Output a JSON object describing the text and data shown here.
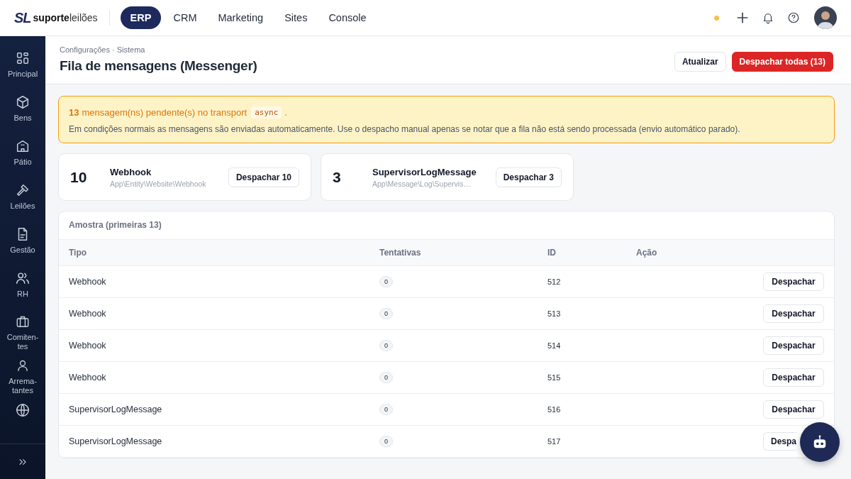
{
  "brand": {
    "mark": "SL",
    "name_bold": "suporte",
    "name_light": "leilões"
  },
  "nav": [
    {
      "label": "ERP",
      "selected": true
    },
    {
      "label": "CRM",
      "selected": false
    },
    {
      "label": "Marketing",
      "selected": false
    },
    {
      "label": "Sites",
      "selected": false
    },
    {
      "label": "Console",
      "selected": false
    }
  ],
  "status_dot": {
    "color": "#fbbf49"
  },
  "sidebar": {
    "items": [
      {
        "label": "Principal"
      },
      {
        "label": "Bens"
      },
      {
        "label": "Pátio"
      },
      {
        "label": "Leilões"
      },
      {
        "label": "Gestão"
      },
      {
        "label": "RH"
      },
      {
        "label": "Comiten-\ntes"
      },
      {
        "label": "Arrema-\ntantes"
      }
    ]
  },
  "header": {
    "breadcrumb": "Configurações · Sistema",
    "title": "Fila de mensagens (Messenger)",
    "buttons": [
      {
        "label": "Atualizar",
        "kind": "secondary"
      },
      {
        "label": "Despachar todas (13)",
        "kind": "danger"
      }
    ]
  },
  "alert": {
    "count": "13",
    "text": "mensagem(ns) pendente(s) no transport",
    "code": "async",
    "end": ".",
    "note": "Em condições normais as mensagens são enviadas automaticamente. Use o despacho manual apenas se notar que a fila não está sendo processada (envio automático parado)."
  },
  "summary": [
    {
      "count": "10",
      "name": "Webhook",
      "class": "App\\Entity\\Website\\Webhook",
      "button": "Despachar 10"
    },
    {
      "count": "3",
      "name": "SupervisorLogMessage",
      "class": "App\\Message\\Log\\Supervis…",
      "button": "Despachar 3"
    }
  ],
  "table": {
    "caption": "Amostra (primeiras 13)",
    "columns": [
      "Tipo",
      "Tentativas",
      "ID",
      "Ação"
    ],
    "rows": [
      {
        "type": "Webhook",
        "attempts": "0",
        "id": "512",
        "action": "Despachar"
      },
      {
        "type": "Webhook",
        "attempts": "0",
        "id": "513",
        "action": "Despachar"
      },
      {
        "type": "Webhook",
        "attempts": "0",
        "id": "514",
        "action": "Despachar"
      },
      {
        "type": "Webhook",
        "attempts": "0",
        "id": "515",
        "action": "Despachar"
      },
      {
        "type": "SupervisorLogMessage",
        "attempts": "0",
        "id": "516",
        "action": "Despachar"
      },
      {
        "type": "SupervisorLogMessage",
        "attempts": "0",
        "id": "517",
        "action": "Despa"
      }
    ]
  }
}
